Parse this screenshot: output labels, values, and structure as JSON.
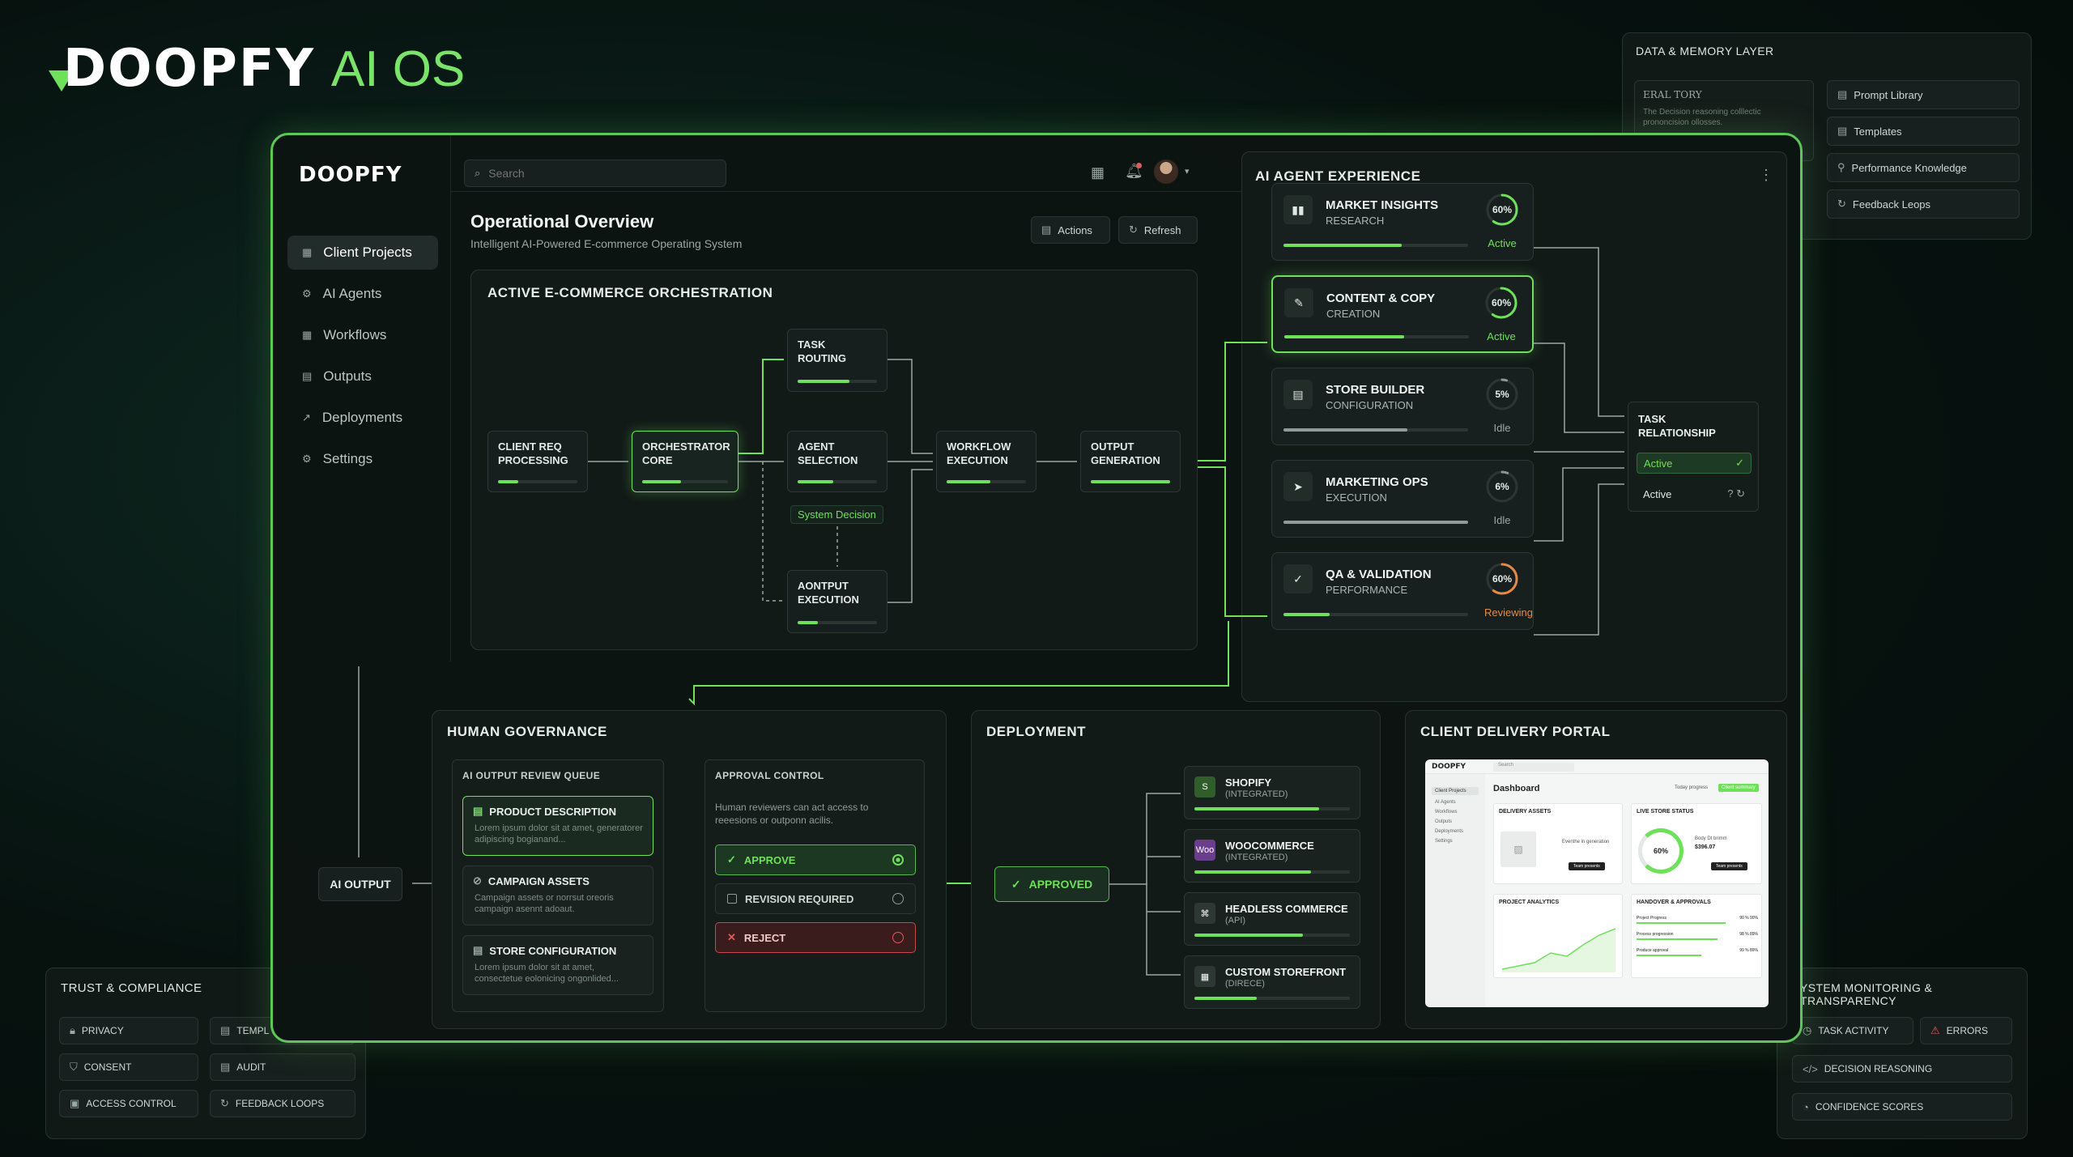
{
  "brand": {
    "logo": "DOOPFY",
    "suffix": "AI OS"
  },
  "data_memory": {
    "title": "DATA & MEMORY LAYER",
    "note_title": "ERAL TORY",
    "note_text": "The Decision reasoning colllectic prononcision ollosses.",
    "items": [
      "Prompt Library",
      "Templates",
      "Performance Knowledge",
      "Feedback Leops"
    ]
  },
  "trust": {
    "title": "TRUST & COMPLIANCE",
    "items": [
      "PRIVACY",
      "TEMPL",
      "CONSENT",
      "AUDIT",
      "ACCESS CONTROL",
      "FEEDBACK LOOPS"
    ]
  },
  "monitoring": {
    "title": "YSTEM MONITORING & TRANSPARENCY",
    "items": [
      "TASK ACTIVITY",
      "ERRORS",
      "DECISION REASONING",
      "CONFIDENCE SCORES"
    ]
  },
  "app": {
    "logo": "DOOPFY",
    "search_placeholder": "Search",
    "sidebar": [
      "Client Projects",
      "AI Agents",
      "Workflows",
      "Outputs",
      "Deployments",
      "Settings"
    ],
    "page_title": "Operational Overview",
    "page_subtitle": "Intelligent AI-Powered E-commerce Operating System",
    "actions_label": "Actions",
    "refresh_label": "Refresh"
  },
  "orchestration": {
    "title": "ACTIVE E-COMMERCE ORCHESTRATION",
    "nodes": [
      {
        "label": "CLIENT REQ PROCESSING",
        "progress": 0.25
      },
      {
        "label": "ORCHESTRATOR CORE",
        "progress": 0.45
      },
      {
        "label": "TASK ROUTING",
        "progress": 0.65
      },
      {
        "label": "AGENT SELECTION",
        "progress": 0.45
      },
      {
        "label": "AONTPUT EXECUTION",
        "progress": 0.25
      },
      {
        "label": "WORKFLOW EXECUTION",
        "progress": 0.55
      },
      {
        "label": "OUTPUT GENERATION",
        "progress": 1.0
      }
    ],
    "decision_label": "System Decision"
  },
  "agent_experience": {
    "title": "AI AGENT EXPERIENCE",
    "agents": [
      {
        "name": "MARKET INSIGHTS",
        "role": "RESEARCH",
        "pct_label": "60%",
        "pct": 0.6,
        "status": "Active",
        "progress": 0.64,
        "ring_color": "#6ee05a",
        "status_color": "#6ee05a"
      },
      {
        "name": "CONTENT & COPY",
        "role": "CREATION",
        "pct_label": "60%",
        "pct": 0.6,
        "status": "Active",
        "progress": 0.65,
        "ring_color": "#6ee05a",
        "status_color": "#6ee05a"
      },
      {
        "name": "STORE BUILDER",
        "role": "CONFIGURATION",
        "pct_label": "5%",
        "pct": 0.05,
        "status": "Idle",
        "progress": 0.67,
        "ring_color": "#8b9893",
        "status_color": "#9aa8a3"
      },
      {
        "name": "MARKETING OPS",
        "role": "EXECUTION",
        "pct_label": "6%",
        "pct": 0.06,
        "status": "Idle",
        "progress": 1.0,
        "ring_color": "#8b9893",
        "status_color": "#9aa8a3"
      },
      {
        "name": "QA & VALIDATION",
        "role": "PERFORMANCE",
        "pct_label": "60%",
        "pct": 0.6,
        "status": "Reviewing",
        "progress": 0.25,
        "ring_color": "#e58a45",
        "status_color": "#e58a45"
      }
    ],
    "task_relationship": {
      "title": "TASK RELATIONSHIP",
      "status1": "Active",
      "status2": "Active"
    }
  },
  "governance": {
    "title": "HUMAN GOVERNANCE",
    "queue_title": "AI OUTPUT REVIEW QUEUE",
    "queue": [
      {
        "title": "PRODUCT DESCRIPTION",
        "desc": "Lorem ipsum dolor sit at amet, generatorer adipiscing bogianand..."
      },
      {
        "title": "CAMPAIGN ASSETS",
        "desc": "Campaign assets or norrsut oreoris campaign asennt adoaut."
      },
      {
        "title": "STORE CONFIGURATION",
        "desc": "Lorem ipsum dolor sit at amet, consectetue eolonicing ongonlided..."
      }
    ],
    "approval_title": "APPROVAL CONTROL",
    "approval_desc": "Human reviewers can act access to reeesions or outponn acilis.",
    "approve": "APPROVE",
    "revision": "REVISION REQUIRED",
    "reject": "REJECT",
    "ai_output": "AI OUTPUT"
  },
  "deployment": {
    "title": "DEPLOYMENT",
    "approved": "APPROVED",
    "targets": [
      {
        "name": "SHOPIFY",
        "sub": "(INTEGRATED)",
        "icon": "S",
        "progress": 0.8
      },
      {
        "name": "WOOCOMMERCE",
        "sub": "(INTEGRATED)",
        "icon": "Woo",
        "progress": 0.75
      },
      {
        "name": "HEADLESS COMMERCE",
        "sub": "(API)",
        "icon": "⌘",
        "progress": 0.7
      },
      {
        "name": "CUSTOM STOREFRONT",
        "sub": "(DIRECE)",
        "icon": "▦",
        "progress": 0.4
      }
    ]
  },
  "portal": {
    "title": "CLIENT DELIVERY PORTAL",
    "logo": "DOOPFY",
    "search": "Search",
    "dashboard": "Dashboard",
    "btn1": "Today progress",
    "btn2": "Client summary",
    "side": [
      "Client Projects",
      "AI Agents",
      "Workflows",
      "Outputs",
      "Deployments",
      "Settings"
    ],
    "delivery_assets": "DELIVERY ASSETS",
    "delivery_text": "Eventhe in generation",
    "delivery_btn": "Team presents",
    "live_status": "LIVE STORE STATUS",
    "live_pct": "60%",
    "live_text": "Body Dt brimm",
    "live_amount": "$396.07",
    "live_btn": "Team presents",
    "analytics": "PROJECT ANALYTICS",
    "handover": "HANDOVER & APPROVALS",
    "handover_rows": [
      {
        "label": "Project Progress",
        "value": "90 % 90%"
      },
      {
        "label": "Process progression",
        "value": "98 % 89%"
      },
      {
        "label": "Produce approval",
        "value": "99 % 89%"
      }
    ]
  },
  "colors": {
    "accent": "#6ee05a",
    "warning": "#e58a45",
    "danger": "#e05a5a"
  }
}
